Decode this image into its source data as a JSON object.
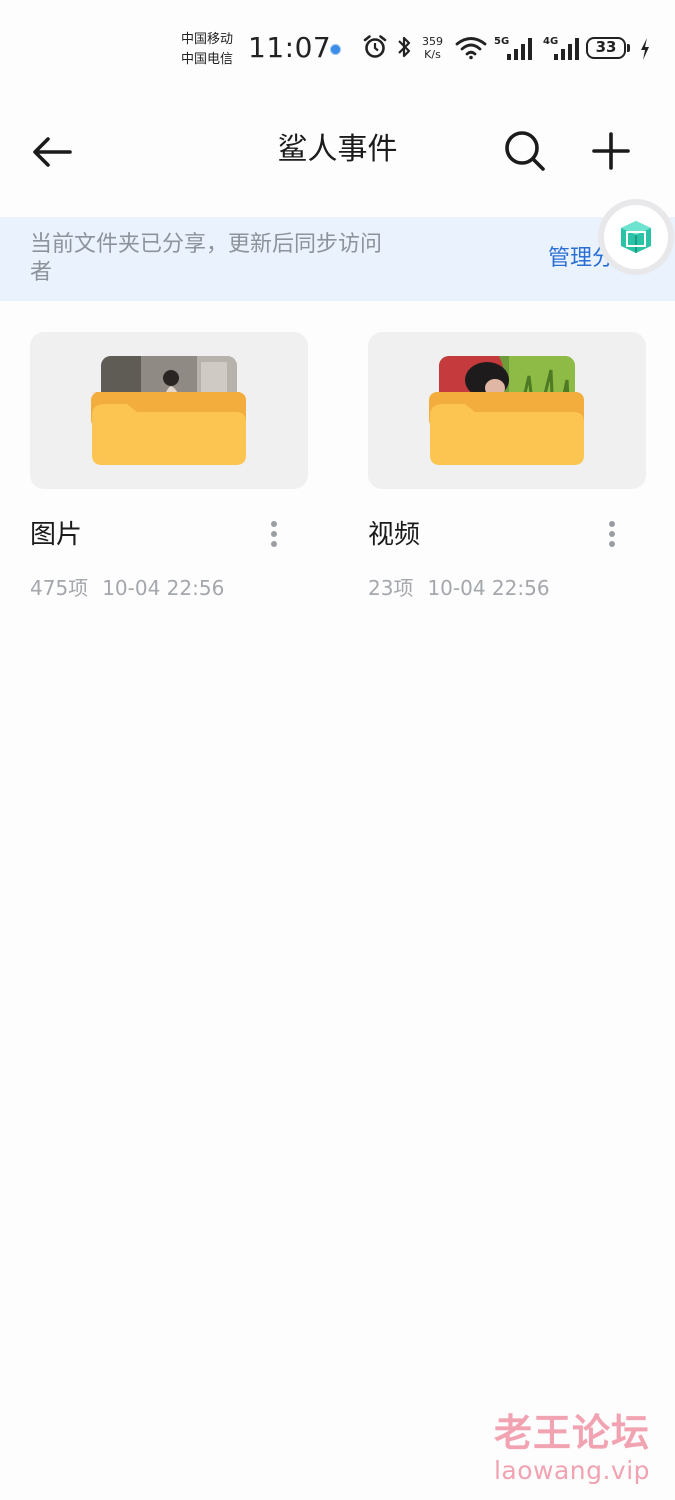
{
  "status_bar": {
    "carrier_1": "中国移动",
    "carrier_2": "中国电信",
    "time": "11:07",
    "net_speed_value": "359",
    "net_speed_unit": "K/s",
    "sim1_network": "5G",
    "sim2_network": "4G",
    "battery": "33",
    "icons": [
      "app-notification-dot-icon",
      "alarm-icon",
      "bluetooth-icon",
      "wifi-icon",
      "signal-icon",
      "signal-icon",
      "battery-icon",
      "charging-bolt-icon"
    ]
  },
  "header": {
    "title": "鲨人事件",
    "icons": [
      "back-arrow-icon",
      "search-icon",
      "plus-icon"
    ]
  },
  "share_banner": {
    "text": "当前文件夹已分享，更新后同步访问者",
    "action_label": "管理分"
  },
  "folders": [
    {
      "name": "图片",
      "count": "475项",
      "modified": "10-04 22:56"
    },
    {
      "name": "视频",
      "count": "23项",
      "modified": "10-04 22:56"
    }
  ],
  "watermark": {
    "title": "老王论坛",
    "url": "laowang.vip"
  },
  "colors": {
    "accent": "#2c6fd4",
    "banner_bg": "#eaf3fd",
    "folder_yellow": "#fcc450",
    "card_bg": "#f0f0f1",
    "watermark": "#f2a3b1"
  }
}
